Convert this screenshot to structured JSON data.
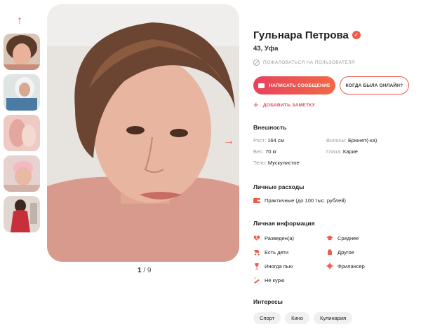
{
  "gallery": {
    "counter_current": "1",
    "counter_total": "/ 9",
    "scroll_up_icon": "arrow-up-icon",
    "next_icon": "arrow-right-icon"
  },
  "profile": {
    "name": "Гульнара Петрова",
    "age_city": "43, Уфа",
    "report_label": "ПОЖАЛОВАТЬСЯ НА ПОЛЬЗОВАТЕЛЯ",
    "message_button": "НАПИСАТЬ СООБЩЕНИЕ",
    "online_button": "КОГДА БЫЛА ОНЛАЙН?",
    "add_note": "ДОБАВИТЬ ЗАМЕТКУ"
  },
  "appearance": {
    "title": "Внешность",
    "height_label": "Рост:",
    "height_value": "164 см",
    "hair_label": "Волосы:",
    "hair_value": "Брюнет(-ка)",
    "weight_label": "Вес:",
    "weight_value": "70 кг",
    "eyes_label": "Глаза:",
    "eyes_value": "Карие",
    "body_label": "Тело:",
    "body_value": "Мускулистое"
  },
  "expenses": {
    "title": "Личные расходы",
    "value": "Практичные (до 100 тыс. рублей)"
  },
  "personal": {
    "title": "Личная информация",
    "items": [
      "Разведен(а)",
      "Среднее",
      "Есть дети",
      "Другое",
      "Иногда пью",
      "Фрилансер",
      "Не курю"
    ]
  },
  "interests": {
    "title": "Интересы",
    "tags": [
      "Спорт",
      "Кино",
      "Кулинария"
    ]
  },
  "colors": {
    "accent": "#ef5a4a",
    "accent_dark": "#e9425d",
    "muted": "#9a9a9a",
    "tag_bg": "#f0f0f0"
  }
}
